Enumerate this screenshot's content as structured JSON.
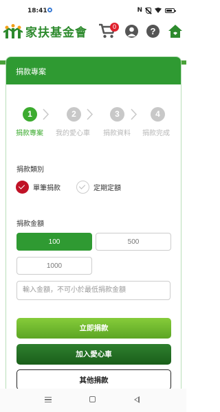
{
  "status_bar": {
    "time": "18:41",
    "nfc": "N",
    "icons": [
      "settings-gear-icon",
      "nfc-icon",
      "mute-icon",
      "wifi-icon",
      "battery-icon"
    ]
  },
  "header": {
    "brand": "家扶基金會",
    "cart_count": "0",
    "help_symbol": "?",
    "icons": [
      "logo-icon",
      "cart-icon",
      "user-icon",
      "help-icon",
      "home-icon"
    ],
    "brand_color": "#2d8a2d"
  },
  "card": {
    "title": "捐款專案"
  },
  "steps": [
    {
      "number": "1",
      "label": "捐款專案",
      "active": true
    },
    {
      "number": "2",
      "label": "我的愛心車",
      "active": false
    },
    {
      "number": "3",
      "label": "捐款資料",
      "active": false
    },
    {
      "number": "4",
      "label": "捐款完成",
      "active": false
    }
  ],
  "donation_type": {
    "title": "捐款類別",
    "options": [
      {
        "label": "單筆捐款",
        "selected": true
      },
      {
        "label": "定期定額",
        "selected": false
      }
    ]
  },
  "amount": {
    "title": "捐款金額",
    "options": [
      {
        "value": "100",
        "selected": true
      },
      {
        "value": "500",
        "selected": false
      },
      {
        "value": "1000",
        "selected": false
      }
    ],
    "custom_placeholder": "輸入金額，不可小於最低捐款金額"
  },
  "actions": {
    "donate_now": "立即捐款",
    "add_to_cart": "加入愛心車",
    "other_donation": "其他捐款"
  },
  "colors": {
    "accent": "#2f9a32",
    "step_active": "#3cab2f",
    "radio_selected": "#c01226",
    "badge": "#e0202c"
  }
}
